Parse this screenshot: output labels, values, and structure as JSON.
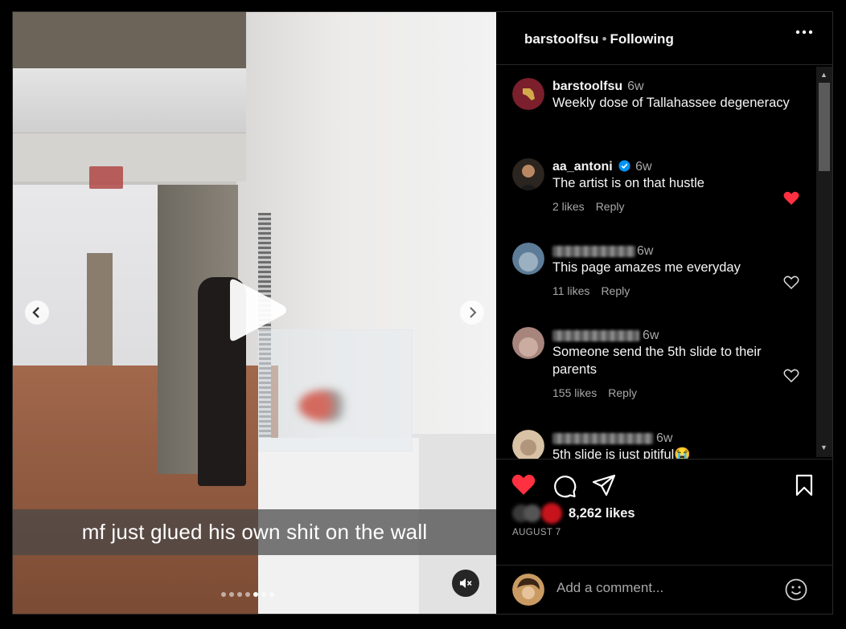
{
  "post": {
    "caption_overlay": "mf just glued his own shit on the wall",
    "slide_count": 7,
    "active_slide": 5
  },
  "header": {
    "username": "barstoolfsu",
    "separator": "•",
    "follow_status": "Following",
    "more_icon": "more-horizontal-icon"
  },
  "author_comment": {
    "username": "barstoolfsu",
    "time": "6w",
    "text": "Weekly dose of Tallahassee degeneracy"
  },
  "comments": [
    {
      "username": "aa_antoni",
      "verified": true,
      "time": "6w",
      "text": "The artist is on that hustle",
      "likes": "2 likes",
      "reply": "Reply",
      "liked": true
    },
    {
      "username": "",
      "time": "6w",
      "text": "This page amazes me everyday",
      "likes": "11 likes",
      "reply": "Reply",
      "liked": false
    },
    {
      "username": "",
      "time": "6w",
      "text": "Someone send the 5th slide to their parents",
      "likes": "155 likes",
      "reply": "Reply",
      "liked": false
    },
    {
      "username": "",
      "time": "6w",
      "text": "5th slide is just pitiful😭",
      "liked": false
    }
  ],
  "actions": {
    "like_icon": "heart-filled-icon",
    "comment_icon": "comment-icon",
    "share_icon": "share-icon",
    "save_icon": "bookmark-icon",
    "likes": "8,262 likes",
    "date": "AUGUST 7"
  },
  "comment_box": {
    "placeholder": "Add a comment...",
    "emoji_icon": "emoji-icon"
  },
  "colors": {
    "like_red": "#ff3040",
    "verified_blue": "#0095f6"
  }
}
